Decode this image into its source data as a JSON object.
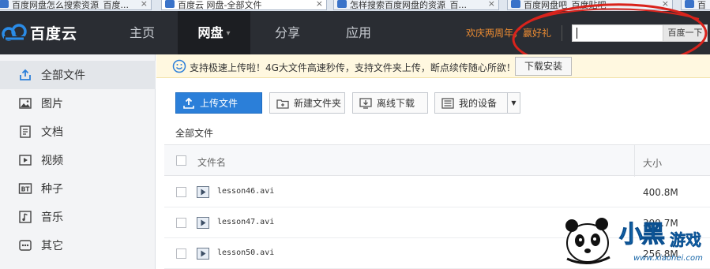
{
  "browser": {
    "tabs": [
      {
        "label": "百度网盘怎么搜索资源_百度...",
        "active": false
      },
      {
        "label": "百度云 网盘-全部文件",
        "active": true
      },
      {
        "label": "怎样搜索百度网盘的资源_百...",
        "active": false
      },
      {
        "label": "百度网盘吧_百度贴吧",
        "active": false
      },
      {
        "label": "百",
        "active": false
      }
    ],
    "close_glyph": "×"
  },
  "header": {
    "logo_text": "百度云",
    "nav": [
      {
        "label": "主页",
        "active": false
      },
      {
        "label": "网盘",
        "active": true
      },
      {
        "label": "分享",
        "active": false
      },
      {
        "label": "应用",
        "active": false
      }
    ],
    "promo": "欢庆两周年，赢好礼",
    "search": {
      "value": "",
      "placeholder": "",
      "button_label": "百度一下"
    },
    "annotation_color": "#d9231c"
  },
  "sidebar": {
    "items": [
      {
        "label": "全部文件",
        "icon": "all-files-icon",
        "active": true
      },
      {
        "label": "图片",
        "icon": "picture-icon",
        "active": false
      },
      {
        "label": "文档",
        "icon": "document-icon",
        "active": false
      },
      {
        "label": "视频",
        "icon": "video-icon",
        "active": false
      },
      {
        "label": "种子",
        "icon": "bt-icon",
        "active": false
      },
      {
        "label": "音乐",
        "icon": "music-icon",
        "active": false
      },
      {
        "label": "其它",
        "icon": "other-icon",
        "active": false
      }
    ]
  },
  "notice": {
    "text": "支持极速上传啦！4G大文件高速秒传，支持文件夹上传，断点续传随心所欲！",
    "button_label": "下载安装"
  },
  "toolbar": {
    "upload_label": "上传文件",
    "new_folder_label": "新建文件夹",
    "offline_download_label": "离线下载",
    "my_devices_label": "我的设备"
  },
  "breadcrumb": "全部文件",
  "table": {
    "columns": {
      "name": "文件名",
      "size": "大小"
    },
    "rows": [
      {
        "name": "lesson46.avi",
        "size": "400.8M"
      },
      {
        "name": "lesson47.avi",
        "size": "399.7M"
      },
      {
        "name": "lesson50.avi",
        "size": "256.8M"
      }
    ]
  },
  "watermark": {
    "brand": "小黑",
    "brand_small": "游戏",
    "url": "www.xiaohei.com"
  },
  "colors": {
    "nav_bg": "#2a2d33",
    "accent": "#2b7fd9",
    "promo": "#e98a33",
    "notice_bg": "#fff8e0"
  }
}
